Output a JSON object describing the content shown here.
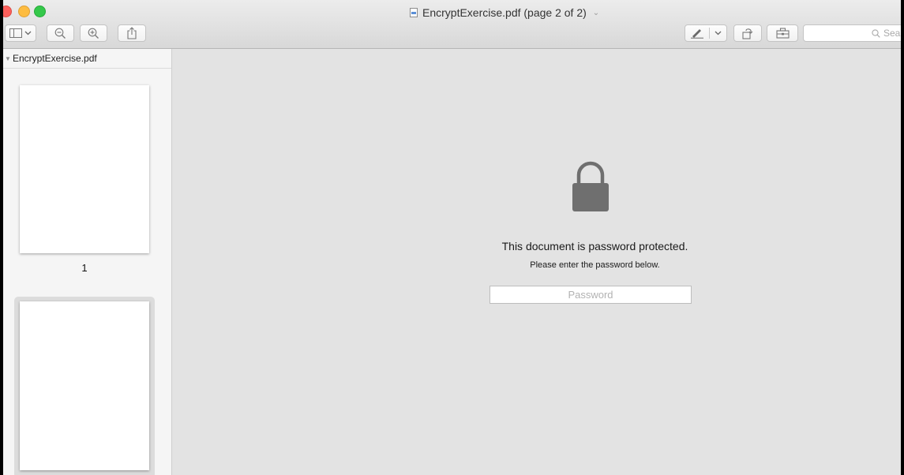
{
  "window": {
    "title": "EncryptExercise.pdf (page 2 of 2)",
    "title_chevron": "⌄"
  },
  "toolbar": {
    "sidebar_toggle_icon": "sidebar-icon",
    "zoom_out_icon": "zoom-out-icon",
    "zoom_in_icon": "zoom-in-icon",
    "share_icon": "share-icon",
    "markup_icon": "pen-icon",
    "rotate_icon": "rotate-icon",
    "toolbox_icon": "toolbox-icon",
    "search_placeholder": "Sea"
  },
  "sidebar": {
    "file_name": "EncryptExercise.pdf",
    "pages": [
      {
        "label": "1"
      },
      {
        "label": ""
      }
    ]
  },
  "main": {
    "lock_icon": "lock-icon",
    "title": "This document is password protected.",
    "subtitle": "Please enter the password below.",
    "password_placeholder": "Password"
  },
  "colors": {
    "close": "#fc605c",
    "minimize": "#fdbc40",
    "maximize": "#34c84a",
    "lock": "#6f6f6f"
  }
}
